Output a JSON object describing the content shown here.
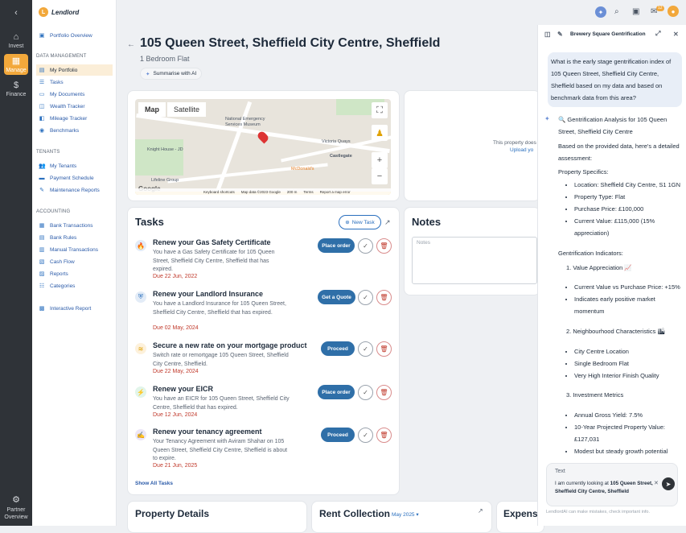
{
  "brand": {
    "name": "Lendlord"
  },
  "rail": [
    {
      "label": "Invest",
      "icon": "house-icon"
    },
    {
      "label": "Manage",
      "icon": "grid-icon"
    },
    {
      "label": "Finance",
      "icon": "dollar-icon"
    },
    {
      "label": "Partner Overview",
      "icon": "partner-icon"
    }
  ],
  "sidebar": {
    "portfolio_overview": "Portfolio Overview",
    "data_mgmt": "DATA MANAGEMENT",
    "items1": [
      "My Portfolio",
      "Tasks",
      "My Documents",
      "Wealth Tracker",
      "Mileage Tracker",
      "Benchmarks"
    ],
    "tenants": "TENANTS",
    "items2": [
      "My Tenants",
      "Payment Schedule",
      "Maintenance Reports"
    ],
    "accounting": "ACCOUNTING",
    "items3": [
      "Bank Transactions",
      "Bank Rules",
      "Manual Transactions",
      "Cash Flow",
      "Reports",
      "Categories"
    ],
    "interactive_report": "Interactive Report"
  },
  "header": {
    "badge": "12"
  },
  "property": {
    "title": "105 Queen Street, Sheffield City Centre, Sheffield",
    "subtitle": "1 Bedroom Flat",
    "ai_button": "Summarise with AI"
  },
  "map": {
    "tab_map": "Map",
    "tab_satellite": "Satellite",
    "labels": [
      "National Emergency",
      "Services Museum",
      "Knight House - JD",
      "Victoria Quays",
      "Castlegate",
      "McDonald's",
      "Lifeline Group"
    ],
    "footer": [
      "Keyboard shortcuts",
      "Map data ©2023 Google",
      "200 m",
      "Terms",
      "Report a map error"
    ],
    "google": "Google"
  },
  "upload": {
    "text": "This property does",
    "link": "Upload yo"
  },
  "tasks": {
    "title": "Tasks",
    "new_task": "New Task",
    "show_all": "Show All Tasks",
    "items": [
      {
        "title": "Renew your Gas Safety Certificate",
        "desc": "You have a Gas Safety Certificate for 105 Queen Street, Sheffield City Centre, Sheffield that has expired.",
        "due": "Due 22 Jun, 2022",
        "action": "Place order"
      },
      {
        "title": "Renew your Landlord Insurance",
        "desc": "You have a Landlord Insurance for 105 Queen Street, Sheffield City Centre, Sheffield that has expired.",
        "due": "Due 02 May, 2024",
        "action": "Get a Quote"
      },
      {
        "title": "Secure a new rate on your mortgage product",
        "desc": "Switch rate or remortgage 105 Queen Street, Sheffield City Centre, Sheffield.",
        "due": "Due 22 May, 2024",
        "action": "Proceed"
      },
      {
        "title": "Renew your EICR",
        "desc": "You have an EICR for 105 Queen Street, Sheffield City Centre, Sheffield that has expired.",
        "due": "Due 12 Jun, 2024",
        "action": "Place order"
      },
      {
        "title": "Renew your tenancy agreement",
        "desc": "Your Tenancy Agreement with Aviram Shahar on 105 Queen Street, Sheffield City Centre, Sheffield is about to expire.",
        "due": "Due 21 Jun, 2025",
        "action": "Proceed"
      }
    ]
  },
  "notes": {
    "title": "Notes",
    "placeholder": "Notes"
  },
  "bottom": {
    "property_details": "Property Details",
    "rent_collection": "Rent Collection",
    "month": "May 2025",
    "expenses": "Expens"
  },
  "chat": {
    "title": "Brewery Square Gentrification",
    "question": "What is the early stage gentrification index of 105 Queen Street, Sheffield City Centre, Sheffield based on my data and based on benchmark data from this area?",
    "heading": "🔍 Gentrification Analysis for 105 Queen Street, Sheffield City Centre",
    "intro": "Based on the provided data, here's a detailed assessment:",
    "specifics_title": "Property Specifics:",
    "specifics": [
      "Location: Sheffield City Centre, S1 1GN",
      "Property Type: Flat",
      "Purchase Price: £100,000",
      "Current Value: £115,000 (15% appreciation)"
    ],
    "indicators_title": "Gentrification Indicators:",
    "n1": "Value Appreciation 📈",
    "n1_items": [
      "Current Value vs Purchase Price: +15%",
      "Indicates early positive market momentum"
    ],
    "n2": "Neighbourhood Characteristics 🏙",
    "n2_items": [
      "City Centre Location",
      "Single Bedroom Flat",
      "Very High Interior Finish Quality"
    ],
    "n3": "Investment Metrics",
    "n3_items": [
      "Annual Gross Yield: 7.5%",
      "10-Year Projected Property Value: £127,031",
      "Modest but steady growth potential"
    ],
    "input_placeholder": "Text",
    "context_prefix": "I am currently looking at",
    "context_bold": "105 Queen Street, Sheffield City Centre, Sheffield",
    "disclaimer": "LendlordAI can make mistakes, check important info."
  }
}
